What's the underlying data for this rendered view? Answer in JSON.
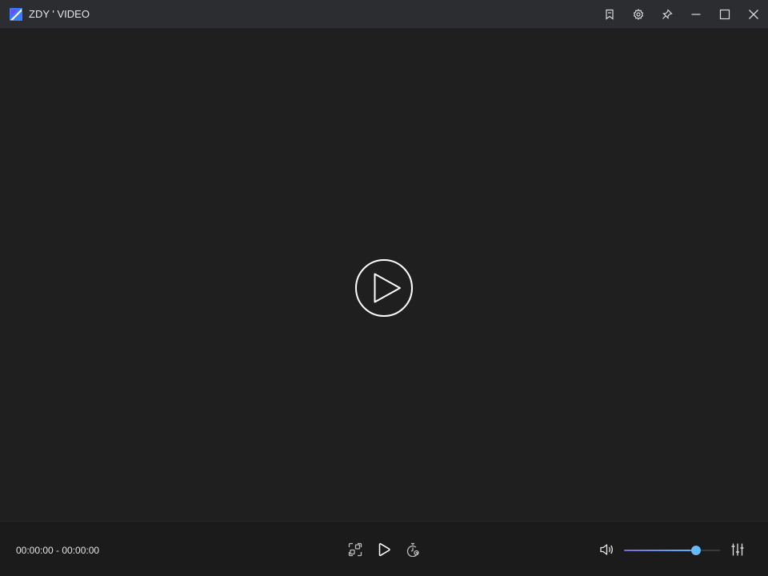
{
  "window": {
    "title": "ZDY ' VIDEO",
    "buttons": [
      "bookmark-icon",
      "gear-icon",
      "pin-icon",
      "minimize-icon",
      "maximize-icon",
      "close-icon"
    ]
  },
  "player": {
    "time_display": "00:00:00 - 00:00:00",
    "volume_percent": 75
  },
  "colors": {
    "titlebar": "#2b2d31",
    "background": "#1f1f1f",
    "controls": "#1b1b1b",
    "accent": "#69b9ff",
    "accent_start": "#7b6fd6"
  }
}
